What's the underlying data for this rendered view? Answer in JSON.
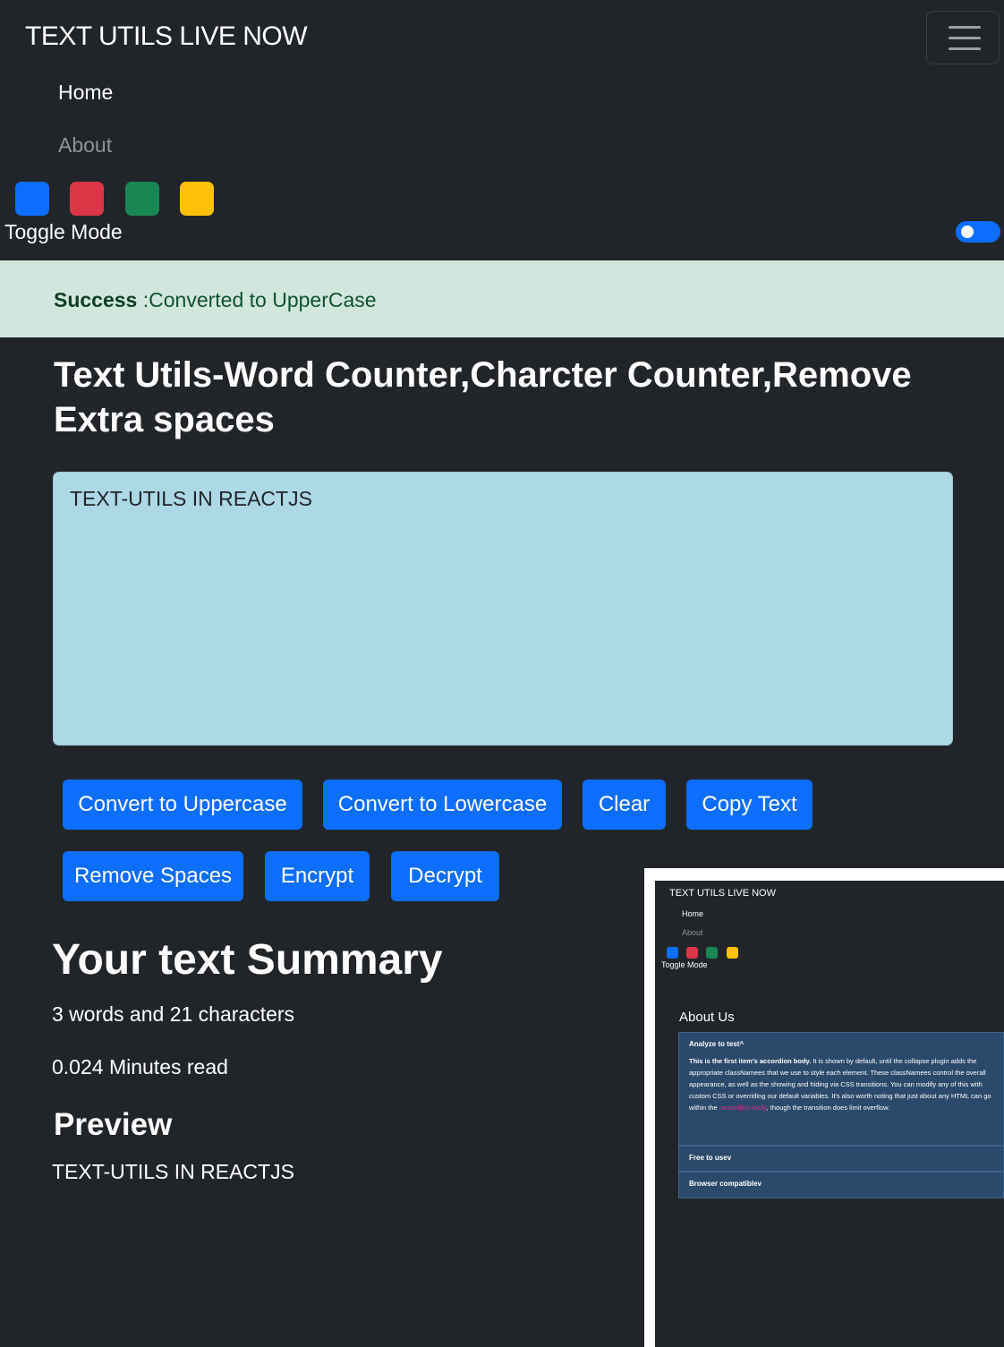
{
  "navbar": {
    "brand": "TEXT UTILS LIVE NOW",
    "links": [
      {
        "label": "Home"
      },
      {
        "label": "About"
      }
    ],
    "color_swatches": [
      {
        "name": "blue",
        "color": "#0d6efd"
      },
      {
        "name": "red",
        "color": "#dc3545"
      },
      {
        "name": "green",
        "color": "#198754"
      },
      {
        "name": "yellow",
        "color": "#ffc107"
      }
    ],
    "toggle_label": "Toggle Mode",
    "toggle_on": true,
    "menu_icon": "hamburger-icon"
  },
  "alert": {
    "type": "Success",
    "message": ":Converted to UpperCase"
  },
  "main": {
    "title": "Text Utils-Word Counter,Charcter Counter,Remove Extra spaces",
    "textarea_value": "TEXT-UTILS IN REACTJS",
    "buttons": [
      {
        "label": "Convert to Uppercase"
      },
      {
        "label": "Convert to Lowercase"
      },
      {
        "label": "Clear"
      },
      {
        "label": "Copy Text"
      },
      {
        "label": "Remove Spaces"
      },
      {
        "label": "Encrypt"
      },
      {
        "label": "Decrypt"
      }
    ]
  },
  "summary": {
    "title": "Your text Summary",
    "counts": "3 words and 21 characters",
    "read_time": "0.024 Minutes read",
    "preview_title": "Preview",
    "preview_text": "TEXT-UTILS IN REACTJS"
  },
  "inset": {
    "brand": "TEXT UTILS LIVE NOW",
    "home": "Home",
    "about": "About",
    "toggle_label": "Toggle Mode",
    "page_title": "About Us",
    "accordion": [
      {
        "header": "Analyze to test",
        "expanded": true,
        "body_bold": "This is the first item's accordion body.",
        "body_text": " It is shown by default, until the collapse plugin adds the appropriate classNamees that we use to style each element. These classNamees control the overall appearance, as well as the showing and hiding via CSS transitions. You can modify any of this with custom CSS or overriding our default variables. It's also worth noting that just about any HTML can go within the ",
        "body_code": ".accordion-body",
        "body_tail": ", though the transition does limit overflow."
      },
      {
        "header": "Free to use",
        "expanded": false
      },
      {
        "header": "Browser compatible",
        "expanded": false
      }
    ],
    "chevron_up": "^",
    "chevron_down": "v"
  }
}
